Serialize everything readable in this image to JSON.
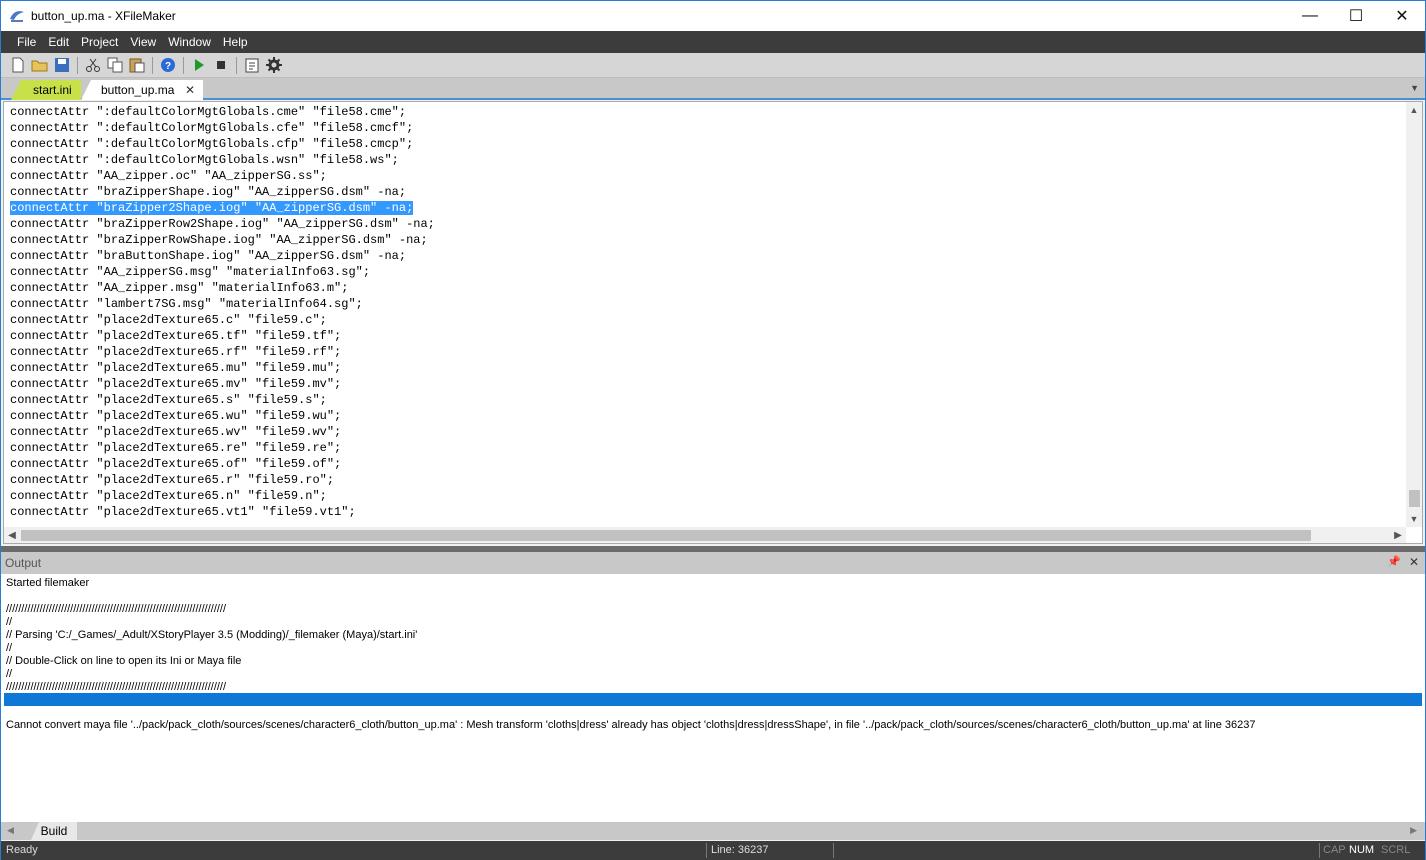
{
  "window": {
    "title": "button_up.ma - XFileMaker",
    "minimize_glyph": "—",
    "maximize_glyph": "☐",
    "close_glyph": "✕"
  },
  "menu": [
    "File",
    "Edit",
    "Project",
    "View",
    "Window",
    "Help"
  ],
  "toolbar": {
    "icons": [
      "new-file-icon",
      "open-folder-icon",
      "save-icon",
      "cut-icon",
      "copy-icon",
      "paste-icon",
      "help-icon",
      "run-icon",
      "stop-icon",
      "clipboard-icon",
      "settings-icon"
    ]
  },
  "tabs": [
    {
      "label": "start.ini"
    },
    {
      "label": "button_up.ma",
      "close": "✕"
    }
  ],
  "editor": {
    "selected_line": 6,
    "lines": [
      "connectAttr \":defaultColorMgtGlobals.cme\" \"file58.cme\";",
      "connectAttr \":defaultColorMgtGlobals.cfe\" \"file58.cmcf\";",
      "connectAttr \":defaultColorMgtGlobals.cfp\" \"file58.cmcp\";",
      "connectAttr \":defaultColorMgtGlobals.wsn\" \"file58.ws\";",
      "connectAttr \"AA_zipper.oc\" \"AA_zipperSG.ss\";",
      "connectAttr \"braZipperShape.iog\" \"AA_zipperSG.dsm\" -na;",
      "connectAttr \"braZipper2Shape.iog\" \"AA_zipperSG.dsm\" -na;",
      "connectAttr \"braZipperRow2Shape.iog\" \"AA_zipperSG.dsm\" -na;",
      "connectAttr \"braZipperRowShape.iog\" \"AA_zipperSG.dsm\" -na;",
      "connectAttr \"braButtonShape.iog\" \"AA_zipperSG.dsm\" -na;",
      "connectAttr \"AA_zipperSG.msg\" \"materialInfo63.sg\";",
      "connectAttr \"AA_zipper.msg\" \"materialInfo63.m\";",
      "connectAttr \"lambert7SG.msg\" \"materialInfo64.sg\";",
      "connectAttr \"place2dTexture65.c\" \"file59.c\";",
      "connectAttr \"place2dTexture65.tf\" \"file59.tf\";",
      "connectAttr \"place2dTexture65.rf\" \"file59.rf\";",
      "connectAttr \"place2dTexture65.mu\" \"file59.mu\";",
      "connectAttr \"place2dTexture65.mv\" \"file59.mv\";",
      "connectAttr \"place2dTexture65.s\" \"file59.s\";",
      "connectAttr \"place2dTexture65.wu\" \"file59.wu\";",
      "connectAttr \"place2dTexture65.wv\" \"file59.wv\";",
      "connectAttr \"place2dTexture65.re\" \"file59.re\";",
      "connectAttr \"place2dTexture65.of\" \"file59.of\";",
      "connectAttr \"place2dTexture65.r\" \"file59.ro\";",
      "connectAttr \"place2dTexture65.n\" \"file59.n\";",
      "connectAttr \"place2dTexture65.vt1\" \"file59.vt1\";"
    ]
  },
  "output": {
    "title": "Output",
    "lines": [
      "Started filemaker",
      "",
      "////////////////////////////////////////////////////////////////////////",
      "//",
      "// Parsing 'C:/_Games/_Adult/XStoryPlayer 3.5 (Modding)/_filemaker (Maya)/start.ini'",
      "//",
      "// Double-Click on line to open its Ini or Maya file",
      "//",
      "////////////////////////////////////////////////////////////////////////",
      "",
      "",
      "Cannot convert maya file '../pack/pack_cloth/sources/scenes/character6_cloth/button_up.ma' : Mesh transform 'cloths|dress' already has object 'cloths|dress|dressShape', in file '../pack/pack_cloth/sources/scenes/character6_cloth/button_up.ma' at line 36237"
    ]
  },
  "bottom_tab": "Build",
  "status": {
    "ready": "Ready",
    "line": "Line: 36237",
    "cap": "CAP",
    "num": "NUM",
    "scrl": "SCRL"
  }
}
